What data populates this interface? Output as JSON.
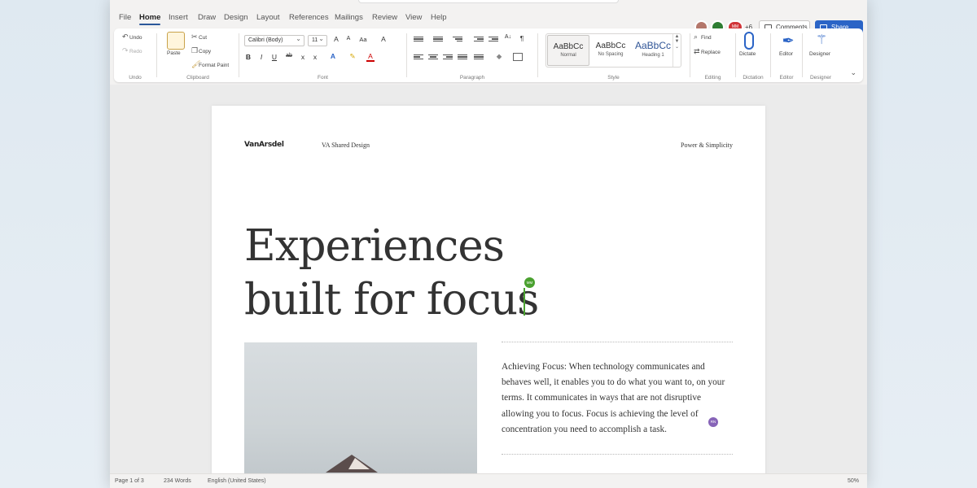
{
  "tabs": [
    "File",
    "Home",
    "Insert",
    "Draw",
    "Design",
    "Layout",
    "References",
    "Mailings",
    "Review",
    "View",
    "Help"
  ],
  "active_tab": "Home",
  "collaborators": {
    "initials": [
      "",
      "",
      "MM"
    ],
    "colors": [
      "#b4776b",
      "#2e7d32",
      "#d13438"
    ],
    "extra_count": "+6"
  },
  "header_buttons": {
    "comments": "Comments",
    "share": "Share"
  },
  "ribbon": {
    "undo": {
      "undo": "Undo",
      "redo": "Redo",
      "label": "Undo"
    },
    "clipboard": {
      "paste": "Paste",
      "cut": "Cut",
      "copy": "Copy",
      "format_painter": "Format Paint",
      "label": "Clipboard"
    },
    "font": {
      "family": "Calibri (Body)",
      "size": "11",
      "label": "Font",
      "bold": "B",
      "italic": "I",
      "underline": "U",
      "strike": "ab",
      "subscript": "x",
      "superscript": "x",
      "grow": "A",
      "shrink": "A",
      "case": "Aa",
      "clear": "A"
    },
    "paragraph": {
      "label": "Paragraph",
      "sort": "A↓",
      "pilcrow": "¶"
    },
    "styles": {
      "items": [
        {
          "sample": "AaBbCc",
          "name": "Normal"
        },
        {
          "sample": "AaBbCc",
          "name": "No Spacing"
        },
        {
          "sample": "AaBbCc",
          "name": "Heading 1"
        }
      ],
      "label": "Style"
    },
    "editing": {
      "find": "Find",
      "replace": "Replace",
      "label": "Editing"
    },
    "dictation": {
      "dictate": "Dictate",
      "label": "Dictation"
    },
    "editor": {
      "editor": "Editor",
      "label": "Editor"
    },
    "designer": {
      "designer": "Designer",
      "label": "Designer"
    }
  },
  "document": {
    "brand": "VanArsdel",
    "header_mid": "VA Shared Design",
    "header_right": "Power & Simplicity",
    "title_line1": "Experiences",
    "title_line2": "built for focus",
    "cursor_initials": "MM",
    "collab_initials": "RN",
    "body": "Achieving Focus: When technology communicates and behaves well, it enables you to do what you want to, on your terms. It communicates in ways that are not disruptive allowing you to focus. Focus is achieving the level of concentration you need to accomplish a task."
  },
  "status": {
    "page": "Page 1 of 3",
    "words": "234 Words",
    "language": "English (United States)",
    "zoom": "50%"
  },
  "colors": {
    "accent": "#2b579a",
    "share": "#2b64c6",
    "cursor": "#4aa12f",
    "collab": "#8764b8"
  }
}
